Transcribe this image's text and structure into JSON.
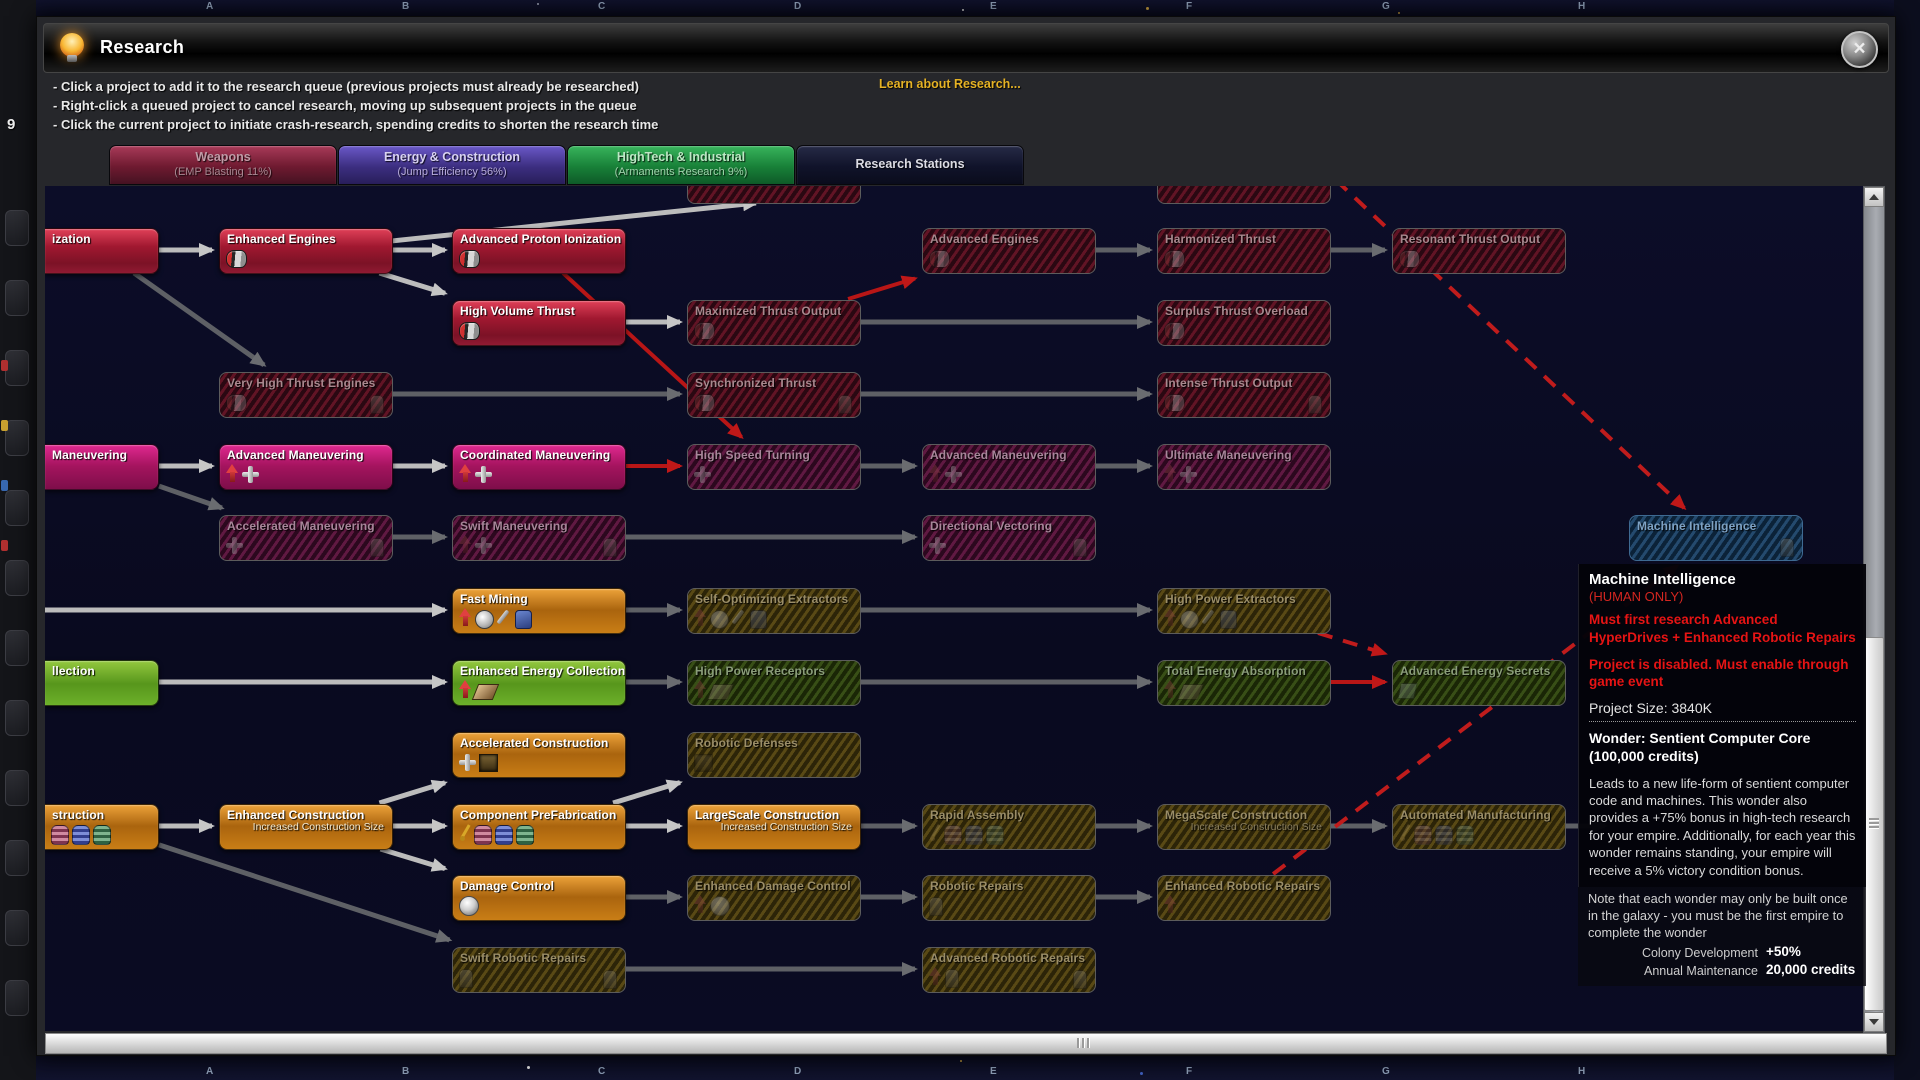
{
  "window": {
    "title": "Research",
    "close_glyph": "×"
  },
  "instructions": [
    "- Click a project to add it to the research queue (previous projects must already be researched)",
    "- Right-click a queued project to cancel research, moving up subsequent projects in the queue",
    "- Click the current project to initiate crash-research, spending credits to shorten the research time"
  ],
  "learn_link": "Learn about Research...",
  "tabs": [
    {
      "label": "Weapons",
      "sub": "(EMP Blasting 11%)",
      "selected": false,
      "color_top": "#a83a58",
      "color_mid": "#6e1a30",
      "color_bottom": "#451222",
      "text_color": "#c09aa6",
      "sub_color": "#a88892"
    },
    {
      "label": "Energy & Construction",
      "sub": "(Jump Efficiency 56%)",
      "selected": true,
      "color_top": "#6a58c8",
      "color_mid": "#3c2e80",
      "color_bottom": "#281e5a",
      "text_color": "#d8d2f2",
      "sub_color": "#b8addc"
    },
    {
      "label": "HighTech & Industrial",
      "sub": "(Armaments Research 9%)",
      "selected": false,
      "color_top": "#38b45c",
      "color_mid": "#188038",
      "color_bottom": "#0e5a28",
      "text_color": "#bce8c4",
      "sub_color": "#a0d4ac"
    },
    {
      "label": "Research Stations",
      "sub": "",
      "selected": false,
      "color_top": "#262a46",
      "color_mid": "#10132a",
      "color_bottom": "#0a0c1c",
      "text_color": "#dcdce4",
      "sub_color": "#dcdce4"
    }
  ],
  "map": {
    "letters": [
      "A",
      "B",
      "C",
      "D",
      "E",
      "F",
      "G",
      "H"
    ],
    "side_number": "9"
  },
  "tree": {
    "nodes": [
      {
        "id": "tp1",
        "col": 3,
        "partial": true,
        "state": "red-dim",
        "label": ""
      },
      {
        "id": "tp2",
        "col": 5,
        "partial": true,
        "state": "red-dim",
        "label": ""
      },
      {
        "id": "r1c0",
        "col": 0,
        "row": 1,
        "cut": true,
        "state": "red",
        "label": "ization"
      },
      {
        "id": "r1c1",
        "col": 1,
        "row": 1,
        "state": "red",
        "label": "Enhanced Engines",
        "icons": [
          "engine"
        ]
      },
      {
        "id": "r1c2",
        "col": 2,
        "row": 1,
        "state": "red",
        "label": "Advanced Proton Ionization",
        "icons": [
          "engine"
        ]
      },
      {
        "id": "r1c4",
        "col": 4,
        "row": 1,
        "state": "red-dim",
        "label": "Advanced Engines",
        "icons": [
          "engine"
        ]
      },
      {
        "id": "r1c5",
        "col": 5,
        "row": 1,
        "state": "red-dim",
        "label": "Harmonized Thrust",
        "icons": [
          "engine"
        ]
      },
      {
        "id": "r1c6",
        "col": 6,
        "row": 1,
        "state": "red-dim",
        "label": "Resonant Thrust Output",
        "icons": [
          "engine"
        ]
      },
      {
        "id": "r2c2",
        "col": 2,
        "row": 2,
        "state": "red",
        "label": "High Volume Thrust",
        "icons": [
          "engine"
        ]
      },
      {
        "id": "r2c3",
        "col": 3,
        "row": 2,
        "state": "red-dim",
        "label": "Maximized Thrust Output",
        "icons": [
          "engine"
        ]
      },
      {
        "id": "r2c5",
        "col": 5,
        "row": 2,
        "state": "red-dim",
        "label": "Surplus Thrust Overload",
        "icons": [
          "engine"
        ]
      },
      {
        "id": "r3c1",
        "col": 1,
        "row": 3,
        "state": "red-dim",
        "label": "Very High Thrust Engines",
        "icons": [
          "engine"
        ],
        "icons_right": [
          "robot"
        ]
      },
      {
        "id": "r3c3",
        "col": 3,
        "row": 3,
        "state": "red-dim",
        "label": "Synchronized Thrust",
        "icons": [
          "engine"
        ],
        "icons_right": [
          "robot"
        ]
      },
      {
        "id": "r3c5",
        "col": 5,
        "row": 3,
        "state": "red-dim",
        "label": "Intense Thrust Output",
        "icons": [
          "engine"
        ],
        "icons_right": [
          "robot"
        ]
      },
      {
        "id": "r4c0",
        "col": 0,
        "row": 4,
        "cut": true,
        "state": "magenta",
        "label": "Maneuvering"
      },
      {
        "id": "r4c1",
        "col": 1,
        "row": 4,
        "state": "magenta",
        "label": "Advanced Maneuvering",
        "icons": [
          "up-arrow",
          "maneuver"
        ]
      },
      {
        "id": "r4c2",
        "col": 2,
        "row": 4,
        "state": "magenta",
        "label": "Coordinated Maneuvering",
        "icons": [
          "up-arrow",
          "maneuver"
        ]
      },
      {
        "id": "r4c3",
        "col": 3,
        "row": 4,
        "state": "magenta-dim",
        "label": "High Speed Turning",
        "icons": [
          "maneuver"
        ]
      },
      {
        "id": "r4c4",
        "col": 4,
        "row": 4,
        "state": "magenta-dim",
        "label": "Advanced Maneuvering",
        "icons": [
          "up-arrow",
          "maneuver"
        ]
      },
      {
        "id": "r4c5",
        "col": 5,
        "row": 4,
        "state": "magenta-dim",
        "label": "Ultimate Maneuvering",
        "icons": [
          "up-arrow",
          "maneuver"
        ]
      },
      {
        "id": "r5c1",
        "col": 1,
        "row": 5,
        "state": "magenta-dim",
        "label": "Accelerated Maneuvering",
        "icons": [
          "maneuver"
        ],
        "icons_right": [
          "robot"
        ]
      },
      {
        "id": "r5c2",
        "col": 2,
        "row": 5,
        "state": "magenta-dim",
        "label": "Swift Maneuvering",
        "icons": [
          "up-arrow",
          "maneuver"
        ],
        "icons_right": [
          "robot"
        ]
      },
      {
        "id": "r5c4",
        "col": 4,
        "row": 5,
        "state": "magenta-dim",
        "label": "Directional Vectoring",
        "icons": [
          "maneuver"
        ],
        "icons_right": [
          "robot"
        ]
      },
      {
        "id": "r6c2",
        "col": 2,
        "row": 6,
        "state": "orange",
        "label": "Fast Mining",
        "icons": [
          "up-arrow",
          "wheel",
          "arm",
          "pack"
        ]
      },
      {
        "id": "r6c3",
        "col": 3,
        "row": 6,
        "state": "olive-dim",
        "label": "Self-Optimizing Extractors",
        "icons": [
          "up-arrow",
          "wheel",
          "arm",
          "pack"
        ]
      },
      {
        "id": "r6c5",
        "col": 5,
        "row": 6,
        "state": "olive-dim",
        "label": "High Power Extractors",
        "icons": [
          "up-arrow",
          "wheel",
          "arm",
          "pack"
        ]
      },
      {
        "id": "r7c0",
        "col": 0,
        "row": 7,
        "cut": true,
        "state": "green",
        "label": "llection"
      },
      {
        "id": "r7c2",
        "col": 2,
        "row": 7,
        "state": "green",
        "label": "Enhanced Energy Collection",
        "icons": [
          "up-arrow",
          "energy-panel"
        ]
      },
      {
        "id": "r7c3",
        "col": 3,
        "row": 7,
        "state": "green-dim",
        "label": "High Power Receptors",
        "icons": [
          "up-arrow",
          "energy-panel"
        ]
      },
      {
        "id": "r7c5",
        "col": 5,
        "row": 7,
        "state": "green-dim",
        "label": "Total Energy Absorption",
        "icons": [
          "up-arrow",
          "energy-panel"
        ]
      },
      {
        "id": "r7c6",
        "col": 6,
        "row": 7,
        "state": "green-dim",
        "label": "Advanced Energy Secrets",
        "icons": [
          "doc"
        ]
      },
      {
        "id": "r8c2",
        "col": 2,
        "row": 8,
        "state": "orange",
        "label": "Accelerated Construction",
        "icons": [
          "cross",
          "crate"
        ]
      },
      {
        "id": "r8c3",
        "col": 3,
        "row": 8,
        "state": "olive-dim",
        "label": "Robotic Defenses",
        "icons": [
          "crate"
        ]
      },
      {
        "id": "r9c0",
        "col": 0,
        "row": 9,
        "cut": true,
        "state": "orange",
        "label": "struction",
        "icons": [
          "barrel-pink",
          "barrel-blue",
          "barrel-green"
        ]
      },
      {
        "id": "r9c1",
        "col": 1,
        "row": 9,
        "state": "orange",
        "label": "Enhanced Construction",
        "sub": "Increased Construction Size"
      },
      {
        "id": "r9c2",
        "col": 2,
        "row": 9,
        "state": "orange",
        "label": "Component PreFabrication",
        "icons": [
          "crane",
          "barrel-pink",
          "barrel-blue",
          "barrel-green"
        ]
      },
      {
        "id": "r9c3",
        "col": 3,
        "row": 9,
        "state": "orange",
        "label": "LargeScale Construction",
        "sub": "Increased Construction Size"
      },
      {
        "id": "r9c4",
        "col": 4,
        "row": 9,
        "state": "olive-dim",
        "label": "Rapid Assembly",
        "icons": [
          "crane",
          "barrel-pink",
          "barrel-blue",
          "barrel-green"
        ]
      },
      {
        "id": "r9c5",
        "col": 5,
        "row": 9,
        "state": "olive-dim",
        "label": "MegaScale Construction",
        "sub": "Increased Construction Size"
      },
      {
        "id": "r9c6",
        "col": 6,
        "row": 9,
        "state": "olive-dim",
        "label": "Automated Manufacturing",
        "icons": [
          "crane",
          "barrel-pink",
          "barrel-blue",
          "barrel-green"
        ]
      },
      {
        "id": "r10c2",
        "col": 2,
        "row": 10,
        "state": "orange",
        "label": "Damage Control",
        "icons": [
          "damage-orb"
        ]
      },
      {
        "id": "r10c3",
        "col": 3,
        "row": 10,
        "state": "olive-dim",
        "label": "Enhanced Damage Control",
        "icons": [
          "up-arrow",
          "damage-orb"
        ]
      },
      {
        "id": "r10c4",
        "col": 4,
        "row": 10,
        "state": "olive-dim",
        "label": "Robotic Repairs",
        "icons": [
          "robot"
        ]
      },
      {
        "id": "r10c5",
        "col": 5,
        "row": 10,
        "state": "olive-dim",
        "label": "Enhanced Robotic Repairs",
        "icons": [
          "up-arrow"
        ]
      },
      {
        "id": "r11c2",
        "col": 2,
        "row": 11,
        "state": "olive-dim",
        "label": "Swift Robotic Repairs",
        "icons": [
          "robot"
        ],
        "icons_right": [
          "robot"
        ]
      },
      {
        "id": "r11c4",
        "col": 4,
        "row": 11,
        "state": "olive-dim",
        "label": "Advanced Robotic Repairs",
        "icons": [
          "up-arrow",
          "robot"
        ],
        "icons_right": [
          "robot"
        ]
      },
      {
        "id": "mi",
        "col": 7,
        "row": 5,
        "state": "blue-dim",
        "label": "Machine Intelligence",
        "icons_right": [
          "robot"
        ]
      }
    ],
    "edges": [
      [
        "r1c0",
        "r1c1",
        "light"
      ],
      [
        "r1c1",
        "r1c2",
        "light"
      ],
      [
        "r1c1",
        "r2c2",
        "light"
      ],
      {
        "from": "r1c1",
        "toPt": [
          711,
          17
        ],
        "style": "light"
      },
      [
        "r2c2",
        "r2c3",
        "light"
      ],
      [
        "r4c0",
        "r4c1",
        "light"
      ],
      [
        "r4c1",
        "r4c2",
        "light"
      ],
      {
        "fromPt": [
          -4,
          424
        ],
        "to": "r6c2",
        "style": "light"
      },
      [
        "r7c0",
        "r7c2",
        "light"
      ],
      [
        "r9c0",
        "r9c1",
        "light"
      ],
      [
        "r9c1",
        "r8c2",
        "light"
      ],
      [
        "r9c1",
        "r9c2",
        "light"
      ],
      [
        "r9c1",
        "r10c2",
        "light"
      ],
      [
        "r9c2",
        "r9c3",
        "light"
      ],
      [
        "r9c2",
        "r8c3",
        "light"
      ],
      [
        "r1c0",
        "r3c1",
        "dark"
      ],
      [
        "r1c4",
        "r1c5",
        "dark"
      ],
      [
        "r1c5",
        "r1c6",
        "dark"
      ],
      [
        "r2c3",
        "r2c5",
        "dark"
      ],
      [
        "r3c1",
        "r3c3",
        "dark"
      ],
      [
        "r3c3",
        "r3c5",
        "dark"
      ],
      [
        "r4c3",
        "r4c4",
        "dark"
      ],
      [
        "r4c4",
        "r4c5",
        "dark"
      ],
      [
        "r4c0",
        "r5c1",
        "dark"
      ],
      [
        "r5c1",
        "r5c2",
        "dark"
      ],
      [
        "r5c2",
        "r5c4",
        "dark"
      ],
      [
        "r6c2",
        "r6c3",
        "dark"
      ],
      [
        "r6c3",
        "r6c5",
        "dark"
      ],
      [
        "r7c2",
        "r7c3",
        "dark"
      ],
      [
        "r7c3",
        "r7c5",
        "dark"
      ],
      [
        "r9c3",
        "r9c4",
        "dark"
      ],
      [
        "r9c4",
        "r9c5",
        "dark"
      ],
      [
        "r9c5",
        "r9c6",
        "dark"
      ],
      {
        "from": "r9c6",
        "toPt": [
          1560,
          640
        ],
        "style": "dark"
      },
      [
        "r10c2",
        "r10c3",
        "dark"
      ],
      [
        "r10c3",
        "r10c4",
        "dark"
      ],
      [
        "r10c4",
        "r10c5",
        "dark"
      ],
      [
        "r9c0",
        "r11c2",
        "dark"
      ],
      [
        "r11c2",
        "r11c4",
        "dark"
      ],
      [
        "r1c2",
        "r4c3",
        "red"
      ],
      [
        "r2c3",
        "r1c4",
        "red"
      ],
      [
        "r4c2",
        "r4c3",
        "red"
      ],
      [
        "r7c5",
        "r7c6",
        "red"
      ],
      {
        "fromPt": [
          1291,
          -6
        ],
        "to": "mi",
        "style": "red-dash"
      },
      [
        "r10c5",
        "mi",
        "red-dash"
      ],
      [
        "r6c5",
        "r7c6",
        "red-dash"
      ]
    ]
  },
  "tooltip": {
    "title": "Machine Intelligence",
    "restriction": "(HUMAN ONLY)",
    "requirement": "Must first research Advanced HyperDrives + Enhanced Robotic Repairs",
    "disabled_note": "Project is disabled. Must enable through game event",
    "project_size": "Project Size: 3840K",
    "wonder": "Wonder: Sentient Computer Core (100,000 credits)",
    "description": "Leads to a new life-form of sentient computer code and machines. This wonder also provides a +75% bonus in high-tech research for your empire. Additionally, for each year this wonder remains standing, your empire will receive a 5% victory condition bonus.",
    "note": "Note that each wonder may only be built once in the galaxy - you must be the first empire to complete the wonder",
    "stats": [
      {
        "label": "Colony Development",
        "value": "+50%"
      },
      {
        "label": "Annual Maintenance",
        "value": "20,000 credits"
      }
    ]
  }
}
